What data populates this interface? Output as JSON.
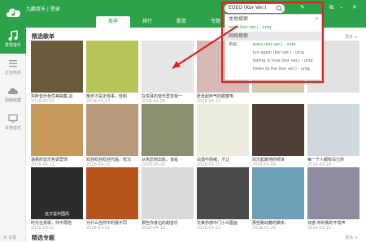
{
  "app": {
    "title": "九酷音乐 | 登录"
  },
  "tabs": [
    {
      "label": "推荐"
    },
    {
      "label": "排行"
    },
    {
      "label": "歌单"
    },
    {
      "label": "专题"
    }
  ],
  "search": {
    "value": "EOEO (Kor Ver.)"
  },
  "dropdown": {
    "local_header": "本地搜索",
    "web_header": "网络搜索",
    "rows": [
      {
        "label": "",
        "text": "eoeo (kor ver.) - uniq"
      },
      {
        "label": "单曲",
        "text": "eoeo (kor ver.) - uniq"
      },
      {
        "label": "",
        "text": "luv again (kor ver.) - uniq"
      },
      {
        "label": "",
        "text": "falling in love (kor ver.) - uniq"
      },
      {
        "label": "",
        "text": "listen to me (kor ver.) - uniq"
      }
    ]
  },
  "sidebar": {
    "items": [
      {
        "label": "发现音乐"
      },
      {
        "label": "正在听的"
      },
      {
        "label": "网络收藏"
      },
      {
        "label": "本地音乐"
      }
    ],
    "footer": "设置"
  },
  "section": {
    "title": "精选歌单",
    "more": "更多",
    "bottom_title": "精选专题"
  },
  "playlists": [
    {
      "title": "买醉音乐色优美曲集,这",
      "date": "2018-05-03",
      "color": "#6a5a3a",
      "caption": ""
    },
    {
      "title": "散步才是正经事，轻和",
      "date": "2018-03-23",
      "color": "#b8c35a",
      "caption": ""
    },
    {
      "title": "在悦耳的音乐里享受一",
      "date": "2018-04-26",
      "color": "#e6e6e6",
      "caption": ""
    },
    {
      "title": "赶走起床气的甜蜜电",
      "date": "2018-04-13",
      "color": "#d9b8b8",
      "caption": ""
    },
    {
      "title": "",
      "date": "",
      "color": "#d7c9b2",
      "caption": ""
    },
    {
      "title": "",
      "date": "",
      "color": "#e2e2e2",
      "caption": ""
    },
    {
      "title": "温柔的音乐色调里饰",
      "date": "2018-04-11",
      "color": "#c79a5b",
      "caption": ""
    },
    {
      "title": "欢迎欢迎欢迎光临，低沉",
      "date": "2018-04-13",
      "color": "#b89a7a",
      "caption": ""
    },
    {
      "title": "从热恋到出轨，该是",
      "date": "2018-05-26",
      "color": "#8a9070",
      "caption": ""
    },
    {
      "title": "白酒与情绪，才让",
      "date": "2018-03-25",
      "color": "#ececdf",
      "caption": ""
    },
    {
      "title": "欢乐起跳地的倾诉",
      "date": "2018-05-09",
      "color": "#4f3f36",
      "caption": ""
    },
    {
      "title": "每一个人都有白己的",
      "date": "2018-03-29",
      "color": "#cfd7df",
      "caption": ""
    },
    {
      "title": "时光在荒歌，你不再陪",
      "date": "2018-03-02",
      "color": "#2c2c2c",
      "caption": "这才是中国风"
    },
    {
      "title": "为什么自然中的我不同",
      "date": "2018-03-02",
      "color": "#b7541e",
      "caption": ""
    },
    {
      "title": "那些你身边的甜音乐",
      "date": "2018-04-13",
      "color": "#d9d9d9",
      "caption": ""
    },
    {
      "title": "优美伤感中门小众图画",
      "date": "2018-03-12",
      "color": "#4a4a4a",
      "caption": ""
    },
    {
      "title": "那些跑动着的脚步，",
      "date": "2018-02-26",
      "color": "#6da0b8",
      "caption": ""
    },
    {
      "title": "双惑 听你我的不发声",
      "date": "2018-03-21",
      "color": "#8e8aa0",
      "caption": ""
    }
  ],
  "colors": {
    "brand": "#2ca24a",
    "highlight": "#e02020"
  }
}
